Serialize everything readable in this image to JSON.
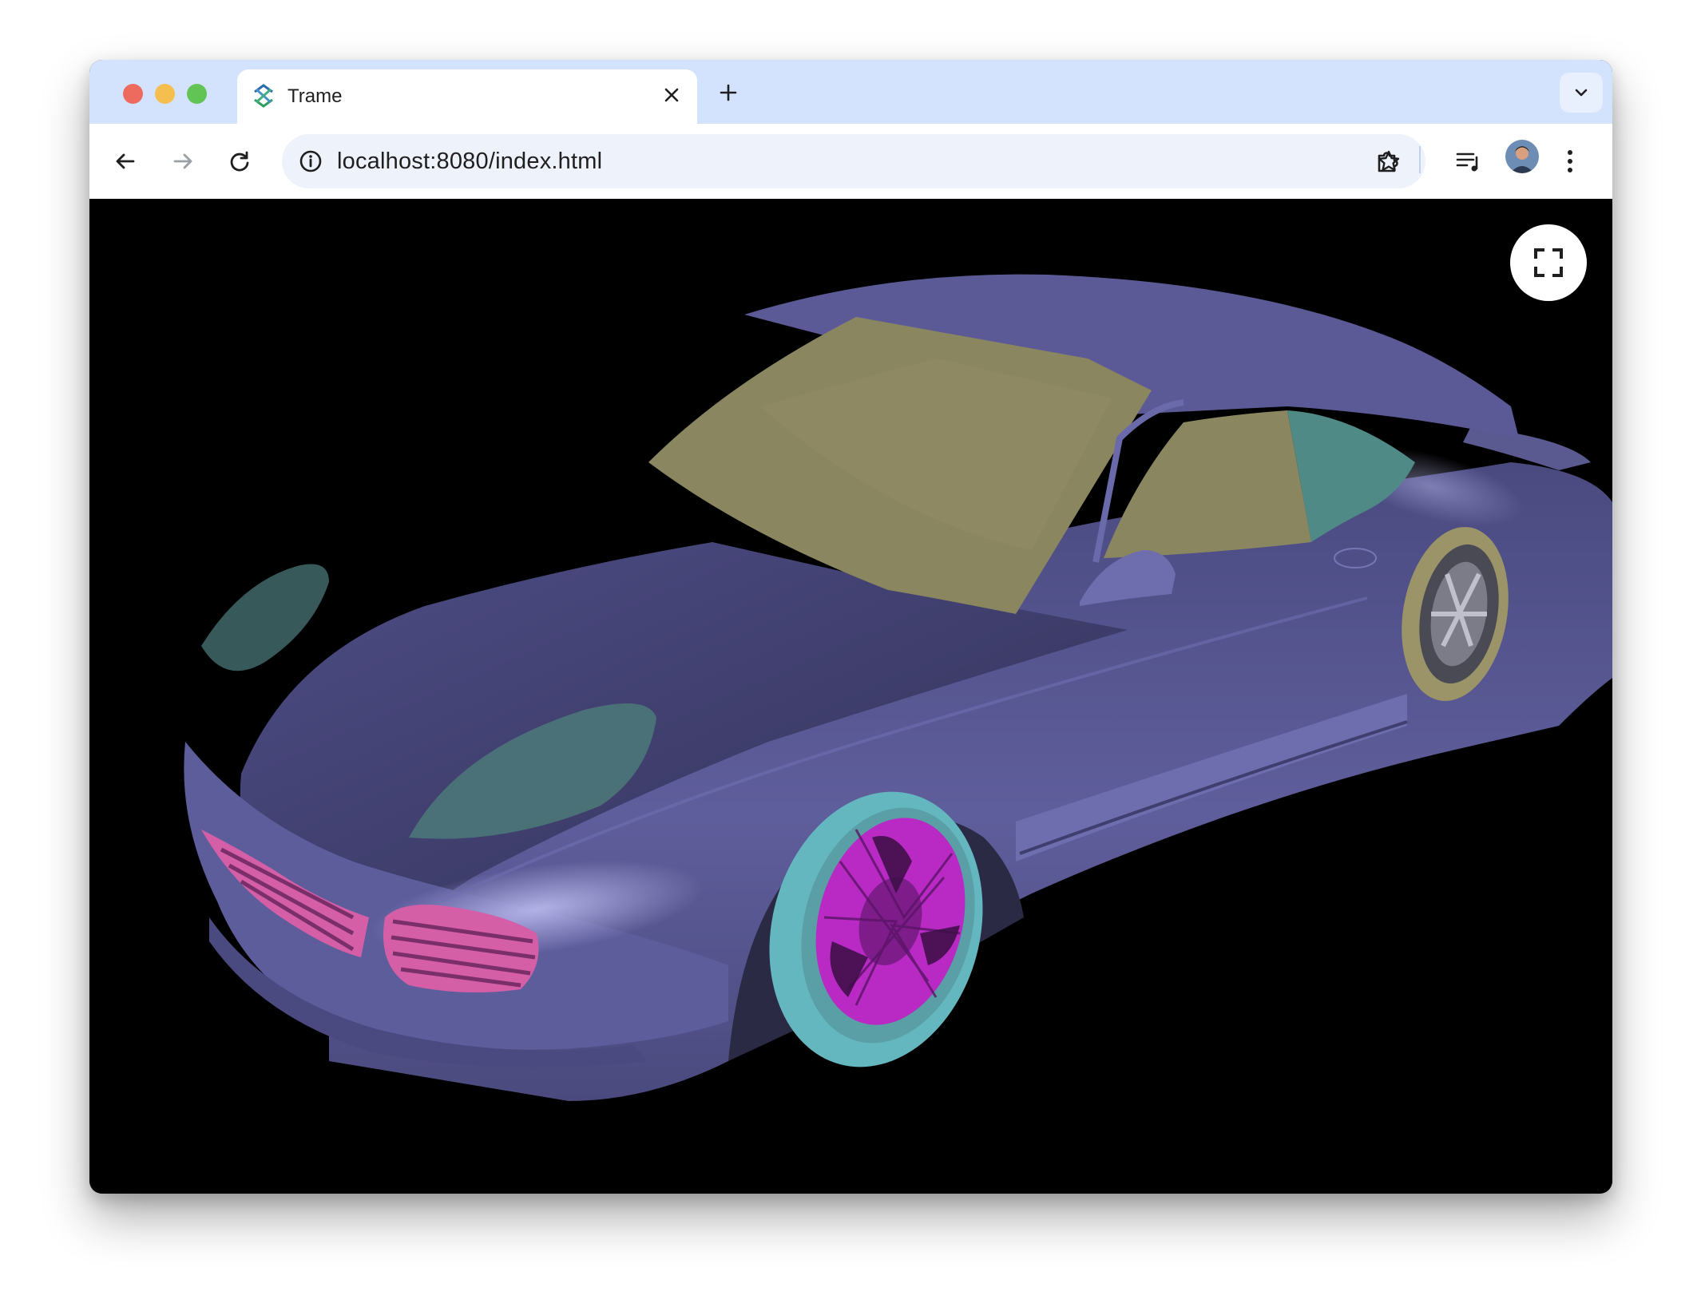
{
  "browser": {
    "tab": {
      "title": "Trame",
      "icon": "trame-logo-icon"
    },
    "url": "localhost:8080/index.html",
    "icons": {
      "back": "arrow-left-icon",
      "forward": "arrow-right-icon",
      "reload": "reload-icon",
      "site_info": "info-icon",
      "bookmark": "star-icon",
      "extensions": "puzzle-icon",
      "media": "playlist-icon",
      "menu": "more-vert-icon"
    }
  },
  "viewer": {
    "background": "#000000",
    "fullscreen_icon": "fullscreen-icon",
    "model_colors": {
      "body": "#5e5d9a",
      "windshield": "#8a8660",
      "side_window": "#4f8a86",
      "headlight": "#4a7778",
      "front_tire": "#65b7bf",
      "front_rim": "#b82ac3",
      "rear_tire": "#9a9468",
      "grille": "#d45fa6"
    }
  },
  "colors": {
    "tabbar": "#d3e3fd",
    "toolbar": "#ffffff",
    "omnibox": "#eef2fb",
    "traffic_red": "#ed6a5e",
    "traffic_yellow": "#f5bf4f",
    "traffic_green": "#61c454"
  }
}
